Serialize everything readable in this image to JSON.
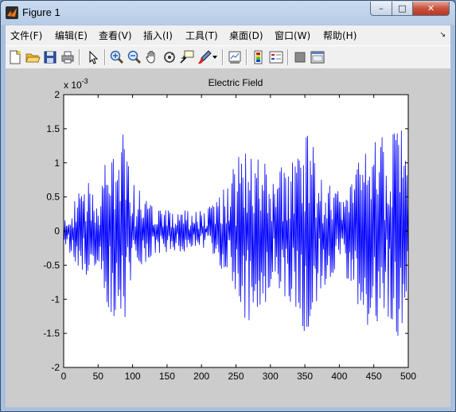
{
  "window": {
    "title": "Figure 1",
    "min_glyph": "–",
    "max_glyph": "□",
    "close_glyph": "✕"
  },
  "menu": {
    "items": [
      "文件(F)",
      "编辑(E)",
      "查看(V)",
      "插入(I)",
      "工具(T)",
      "桌面(D)",
      "窗口(W)",
      "帮助(H)"
    ],
    "overflow": "↘"
  },
  "toolbar": {
    "buttons": [
      "new-figure",
      "open-file",
      "save",
      "print",
      "edit-plot",
      "zoom-in",
      "zoom-out",
      "pan",
      "rotate-3d",
      "data-cursor",
      "brush",
      "brush-menu",
      "link-plot",
      "insert-colorbar",
      "insert-legend",
      "hide-plot-tools",
      "show-plot-tools"
    ]
  },
  "colors": {
    "signal": "#0000ff",
    "figure_bg": "#cccccc",
    "axes_bg": "#ffffff"
  },
  "chart_data": {
    "type": "line",
    "title": "Electric Field",
    "xlabel": "",
    "ylabel": "",
    "exponent_label": "x 10",
    "exponent_power": "-3",
    "xlim": [
      0,
      500
    ],
    "ylim": [
      -2,
      2
    ],
    "xticks": [
      "0",
      "50",
      "100",
      "150",
      "200",
      "250",
      "300",
      "350",
      "400",
      "450",
      "500"
    ],
    "yticks": [
      "2",
      "1.5",
      "1",
      "0.5",
      "0",
      "-0.5",
      "-1",
      "-1.5",
      "-2"
    ],
    "grid": false,
    "series": [
      {
        "color": "#0000ff",
        "sample_count": 501,
        "envelope": [
          [
            0,
            0.15
          ],
          [
            10,
            0.35
          ],
          [
            25,
            0.65
          ],
          [
            35,
            0.75
          ],
          [
            50,
            0.45
          ],
          [
            60,
            1.0
          ],
          [
            70,
            1.35
          ],
          [
            80,
            1.2
          ],
          [
            85,
            1.55
          ],
          [
            95,
            1.0
          ],
          [
            110,
            0.6
          ],
          [
            130,
            0.35
          ],
          [
            160,
            0.3
          ],
          [
            200,
            0.3
          ],
          [
            220,
            0.4
          ],
          [
            240,
            0.8
          ],
          [
            260,
            1.3
          ],
          [
            275,
            1.4
          ],
          [
            290,
            1.15
          ],
          [
            300,
            0.9
          ],
          [
            315,
            1.0
          ],
          [
            330,
            1.2
          ],
          [
            350,
            1.55
          ],
          [
            365,
            1.2
          ],
          [
            380,
            0.8
          ],
          [
            400,
            0.6
          ],
          [
            420,
            0.9
          ],
          [
            440,
            1.4
          ],
          [
            455,
            1.5
          ],
          [
            470,
            1.3
          ],
          [
            480,
            1.7
          ],
          [
            490,
            1.5
          ],
          [
            500,
            0.9
          ]
        ]
      }
    ]
  }
}
